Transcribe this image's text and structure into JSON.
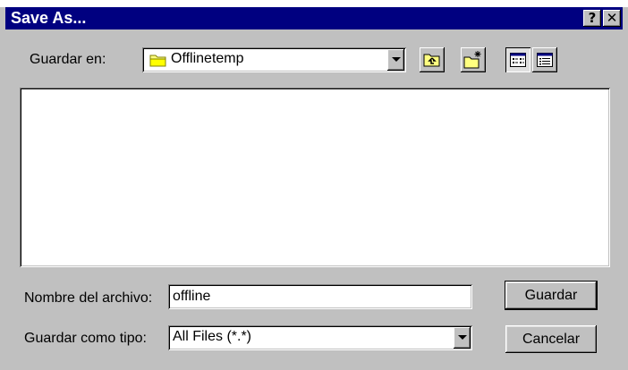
{
  "window": {
    "title": "Save As...",
    "help_button": "?",
    "close_button": "✕"
  },
  "location": {
    "label": "Guardar en:",
    "current_folder": "Offlinetemp"
  },
  "toolbar": {
    "icons": [
      "up-one-level-icon",
      "create-new-folder-icon",
      "list-view-icon",
      "details-view-icon"
    ]
  },
  "file_list": {
    "items": []
  },
  "filename": {
    "label": "Nombre del archivo:",
    "value": "offline"
  },
  "filetype": {
    "label": "Guardar como tipo:",
    "value": "All Files (*.*)"
  },
  "buttons": {
    "save": "Guardar",
    "cancel": "Cancelar"
  },
  "colors": {
    "titlebar": "#000080",
    "face": "#c0c0c0"
  }
}
